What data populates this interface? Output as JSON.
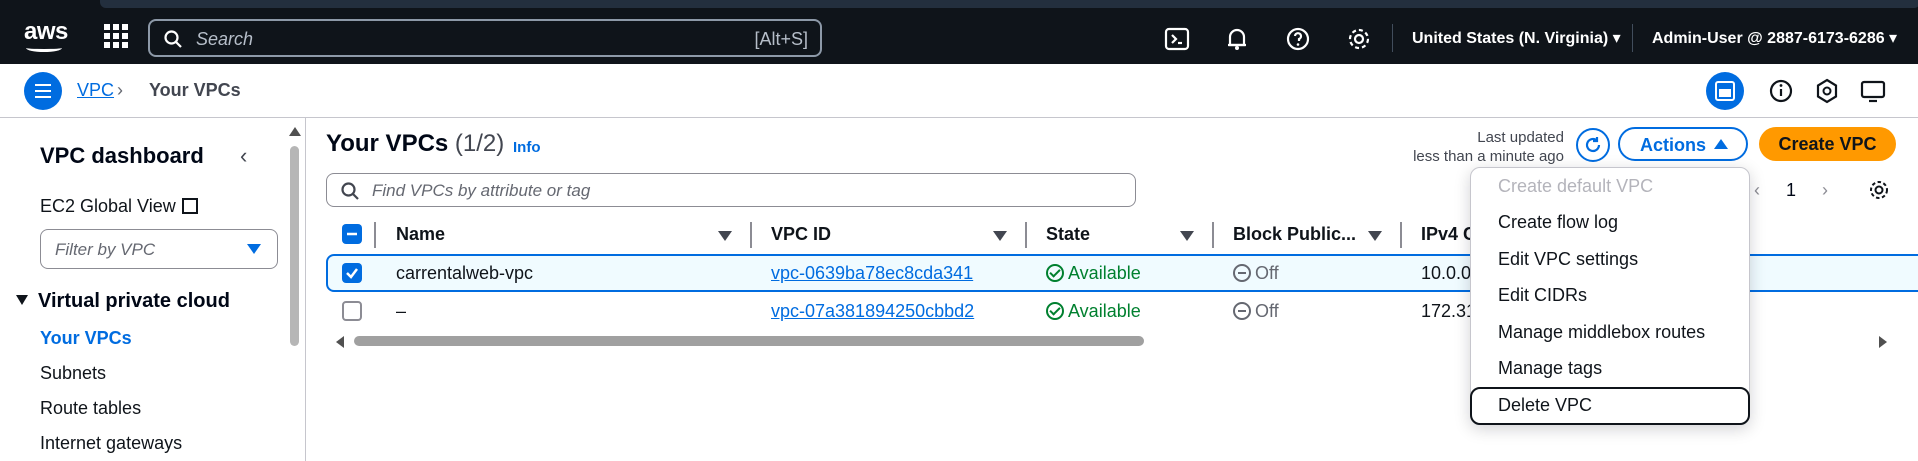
{
  "topbar": {
    "logo": "aws",
    "search_placeholder": "Search",
    "search_shortcut": "[Alt+S]",
    "region": "United States (N. Virginia) ▾",
    "account": "Admin-User @ 2887-6173-6286 ▾",
    "icons": [
      "cloudshell-icon",
      "bell-icon",
      "help-icon",
      "settings-icon"
    ]
  },
  "breadcrumb": {
    "root": "VPC",
    "separator": "›",
    "current": "Your VPCs"
  },
  "sidebar": {
    "title": "VPC dashboard",
    "collapse": "‹",
    "global_view": "EC2 Global View",
    "filter_placeholder": "Filter by VPC",
    "section": "Virtual private cloud",
    "items": [
      {
        "label": "Your VPCs",
        "active": true
      },
      {
        "label": "Subnets",
        "active": false
      },
      {
        "label": "Route tables",
        "active": false
      },
      {
        "label": "Internet gateways",
        "active": false
      }
    ]
  },
  "main": {
    "title": "Your VPCs",
    "count": "(1/2)",
    "info": "Info",
    "last_updated_line1": "Last updated",
    "last_updated_line2": "less than a minute ago",
    "actions_label": "Actions",
    "create_label": "Create VPC",
    "find_placeholder": "Find VPCs by attribute or tag",
    "pager_prev": "‹",
    "pager_page": "1",
    "pager_next": "›"
  },
  "table": {
    "columns": [
      "Name",
      "VPC ID",
      "State",
      "Block Public...",
      "IPv4 C"
    ],
    "rows": [
      {
        "selected": true,
        "name": "carrentalweb-vpc",
        "vpc_id": "vpc-0639ba78ec8cda341",
        "state": "Available",
        "block": "Off",
        "ipv4": "10.0.0"
      },
      {
        "selected": false,
        "name": "–",
        "vpc_id": "vpc-07a381894250cbbd2",
        "state": "Available",
        "block": "Off",
        "ipv4": "172.31"
      }
    ]
  },
  "actions_menu": {
    "items": [
      {
        "label": "Create default VPC",
        "disabled": true
      },
      {
        "label": "Create flow log",
        "disabled": false
      },
      {
        "label": "Edit VPC settings",
        "disabled": false
      },
      {
        "label": "Edit CIDRs",
        "disabled": false
      },
      {
        "label": "Manage middlebox routes",
        "disabled": false
      },
      {
        "label": "Manage tags",
        "disabled": false
      },
      {
        "label": "Delete VPC",
        "disabled": false
      }
    ]
  },
  "colors": {
    "accent": "#006ce0",
    "create_button": "#ff9900",
    "available": "#00802f",
    "topbar": "#0f141a"
  }
}
